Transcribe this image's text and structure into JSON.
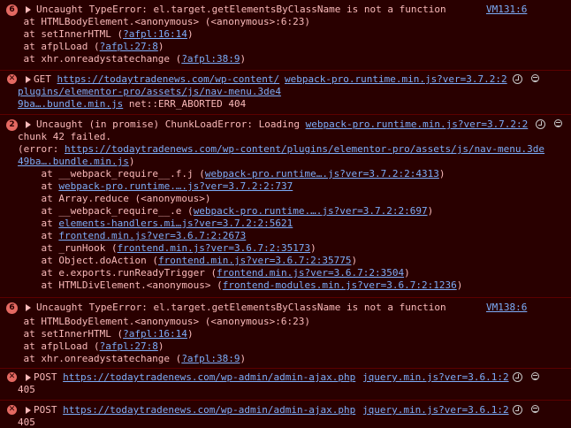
{
  "colors": {
    "background": "#290000",
    "text": "#f9b9b9",
    "link": "#7cacf8",
    "badge": "#e46962"
  },
  "entries": [
    {
      "badge": "6",
      "message": "Uncaught TypeError: el.target.getElementsByClassName is not a function",
      "source": "VM131:6",
      "stack": [
        {
          "prefix": "    at HTMLBodyElement.<anonymous> (<anonymous>:6:23)",
          "link": "",
          "suffix": ""
        },
        {
          "prefix": "    at setInnerHTML (",
          "link": "?afpl:16:14",
          "suffix": ")"
        },
        {
          "prefix": "    at afplLoad (",
          "link": "?afpl:27:8",
          "suffix": ")"
        },
        {
          "prefix": "    at xhr.onreadystatechange (",
          "link": "?afpl:38:9",
          "suffix": ")"
        }
      ]
    },
    {
      "icon": "error-icon",
      "method": "GET",
      "url_line1": "https://todaytradenews.com/wp-content/",
      "url_line2": "plugins/elementor-pro/assets/js/nav-menu.3de4",
      "url_line3": "9ba….bundle.min.js",
      "status": " net::ERR_ABORTED 404",
      "source": "webpack-pro.runtime.min.js?ver=3.7.2:2"
    },
    {
      "badge": "2",
      "message": "Uncaught (in promise) ChunkLoadError: Loading ",
      "message_link": "webpack-pro.runtime.min.js?ver=3.7.2:2",
      "line2": "chunk 42 failed.",
      "line3_prefix": "(error: ",
      "line3_link": "https://todaytradenews.com/wp-content/plugins/elementor-pro/assets/js/nav-menu.3de",
      "line4_link": "49ba….bundle.min.js",
      "line4_suffix": ")",
      "stack": [
        {
          "prefix": "    at __webpack_require__.f.j (",
          "link": "webpack-pro.runtime….js?ver=3.7.2:2:4313",
          "suffix": ")"
        },
        {
          "prefix": "    at ",
          "link": "webpack-pro.runtime.….js?ver=3.7.2:2:737",
          "suffix": ""
        },
        {
          "prefix": "    at Array.reduce (<anonymous>)",
          "link": "",
          "suffix": ""
        },
        {
          "prefix": "    at __webpack_require__.e (",
          "link": "webpack-pro.runtime.….js?ver=3.7.2:2:697",
          "suffix": ")"
        },
        {
          "prefix": "    at ",
          "link": "elements-handlers.mi…js?ver=3.7.2:2:5621",
          "suffix": ""
        },
        {
          "prefix": "    at ",
          "link": "frontend.min.js?ver=3.6.7:2:2673",
          "suffix": ""
        },
        {
          "prefix": "    at _runHook (",
          "link": "frontend.min.js?ver=3.6.7:2:35173",
          "suffix": ")"
        },
        {
          "prefix": "    at Object.doAction (",
          "link": "frontend.min.js?ver=3.6.7:2:35775",
          "suffix": ")"
        },
        {
          "prefix": "    at e.exports.runReadyTrigger (",
          "link": "frontend.min.js?ver=3.6.7:2:3504",
          "suffix": ")"
        },
        {
          "prefix": "    at HTMLDivElement.<anonymous> (",
          "link": "frontend-modules.min.js?ver=3.6.7:2:1236",
          "suffix": ")"
        }
      ]
    },
    {
      "badge": "6",
      "message": "Uncaught TypeError: el.target.getElementsByClassName is not a function",
      "source": "VM138:6",
      "stack": [
        {
          "prefix": "    at HTMLBodyElement.<anonymous> (<anonymous>:6:23)",
          "link": "",
          "suffix": ""
        },
        {
          "prefix": "    at setInnerHTML (",
          "link": "?afpl:16:14",
          "suffix": ")"
        },
        {
          "prefix": "    at afplLoad (",
          "link": "?afpl:27:8",
          "suffix": ")"
        },
        {
          "prefix": "    at xhr.onreadystatechange (",
          "link": "?afpl:38:9",
          "suffix": ")"
        }
      ]
    },
    {
      "method": "POST",
      "url": "https://todaytradenews.com/wp-admin/admin-ajax.php",
      "status": "405",
      "source": "jquery.min.js?ver=3.6.1:2"
    },
    {
      "method": "POST",
      "url": "https://todaytradenews.com/wp-admin/admin-ajax.php",
      "status": "405",
      "source": "jquery.min.js?ver=3.6.1:2"
    }
  ]
}
